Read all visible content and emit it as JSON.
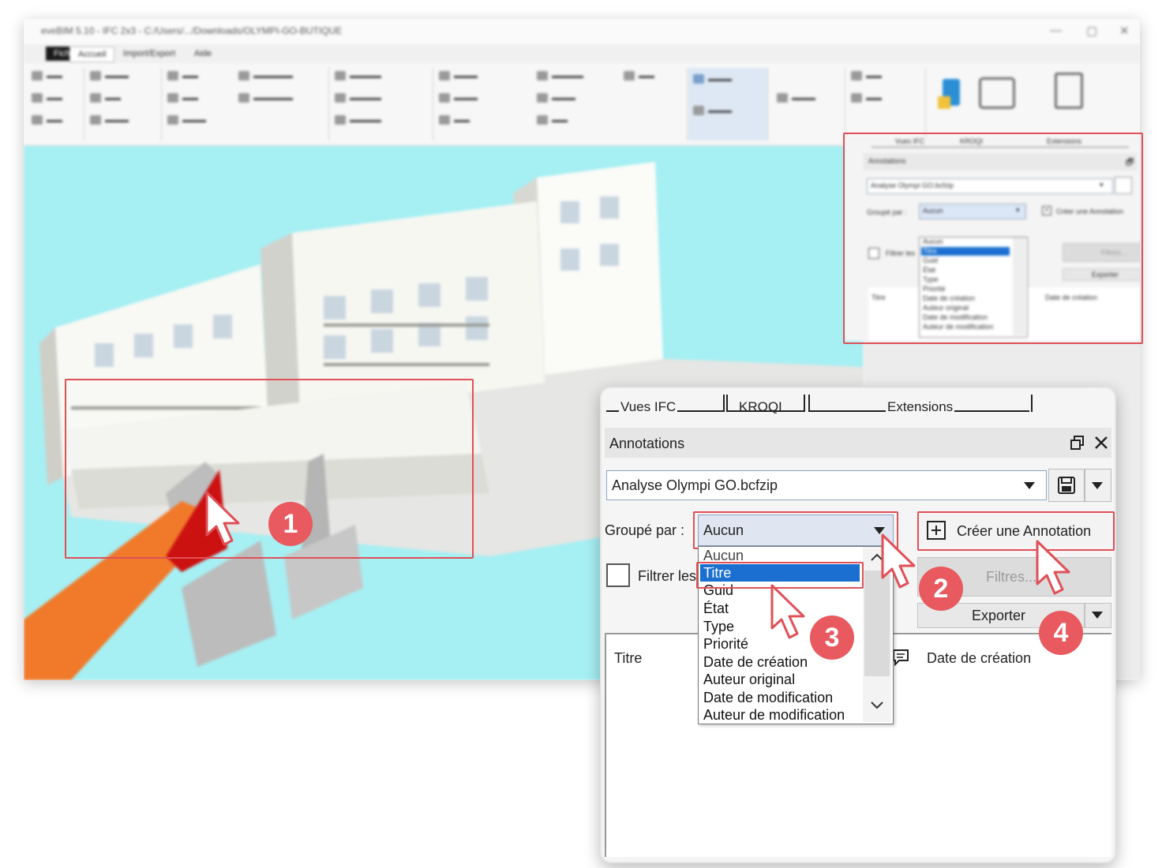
{
  "app": {
    "window_title": "eveBIM 5.10 - IFC 2x3 - C:/Users/.../Downloads/OLYMPI-GO-BUTIQUE",
    "ribbon_tabs": [
      "Fichier",
      "Accueil",
      "Import/Export",
      "Aide"
    ],
    "viewport_bg": "#a6eff3"
  },
  "small_panel": {
    "tabs": [
      "Vues IFC",
      "KROQI",
      "Extensions"
    ],
    "header": "Annotations",
    "file": "Analyse Olympi GO.bcfzip",
    "group_label": "Groupé par :",
    "group_value": "Aucun",
    "create_label": "Créer une Annotation",
    "filter_label": "Filtrer les",
    "filters_btn": "Filtres...",
    "export_btn": "Exporter",
    "col_title": "Titre",
    "col_date": "Date de création",
    "options": [
      "Aucun",
      "Titre",
      "Guid",
      "État",
      "Type",
      "Priorité",
      "Date de création",
      "Auteur original",
      "Date de modification",
      "Auteur de modification"
    ]
  },
  "zoom_panel": {
    "tabs": [
      "Vues IFC",
      "KROQI",
      "Extensions"
    ],
    "header": "Annotations",
    "file": "Analyse Olympi GO.bcfzip",
    "group_label": "Groupé par :",
    "group_value": "Aucun",
    "create_label": "Créer une Annotation",
    "filter_label": "Filtrer les",
    "filters_btn": "Filtres...",
    "export_btn": "Exporter",
    "col_title": "Titre",
    "col_date": "Date de création",
    "options": [
      "Aucun",
      "Titre",
      "Guid",
      "État",
      "Type",
      "Priorité",
      "Date de création",
      "Auteur original",
      "Date de modification",
      "Auteur de modification"
    ],
    "selected_option": "Titre"
  },
  "steps": [
    "1",
    "2",
    "3",
    "4"
  ],
  "colors": {
    "highlight_red": "#e05057",
    "badge_red": "#e85a5f",
    "selection_blue": "#1a6fd0",
    "wall_red": "#cc1111",
    "floor_orange": "#f07a2a"
  },
  "icons": {
    "save": "floppy-disk-icon",
    "dropdown": "chevron-down-icon",
    "restore": "restore-window-icon",
    "close": "close-icon",
    "add": "plus-box-icon",
    "comment": "comment-icon"
  }
}
